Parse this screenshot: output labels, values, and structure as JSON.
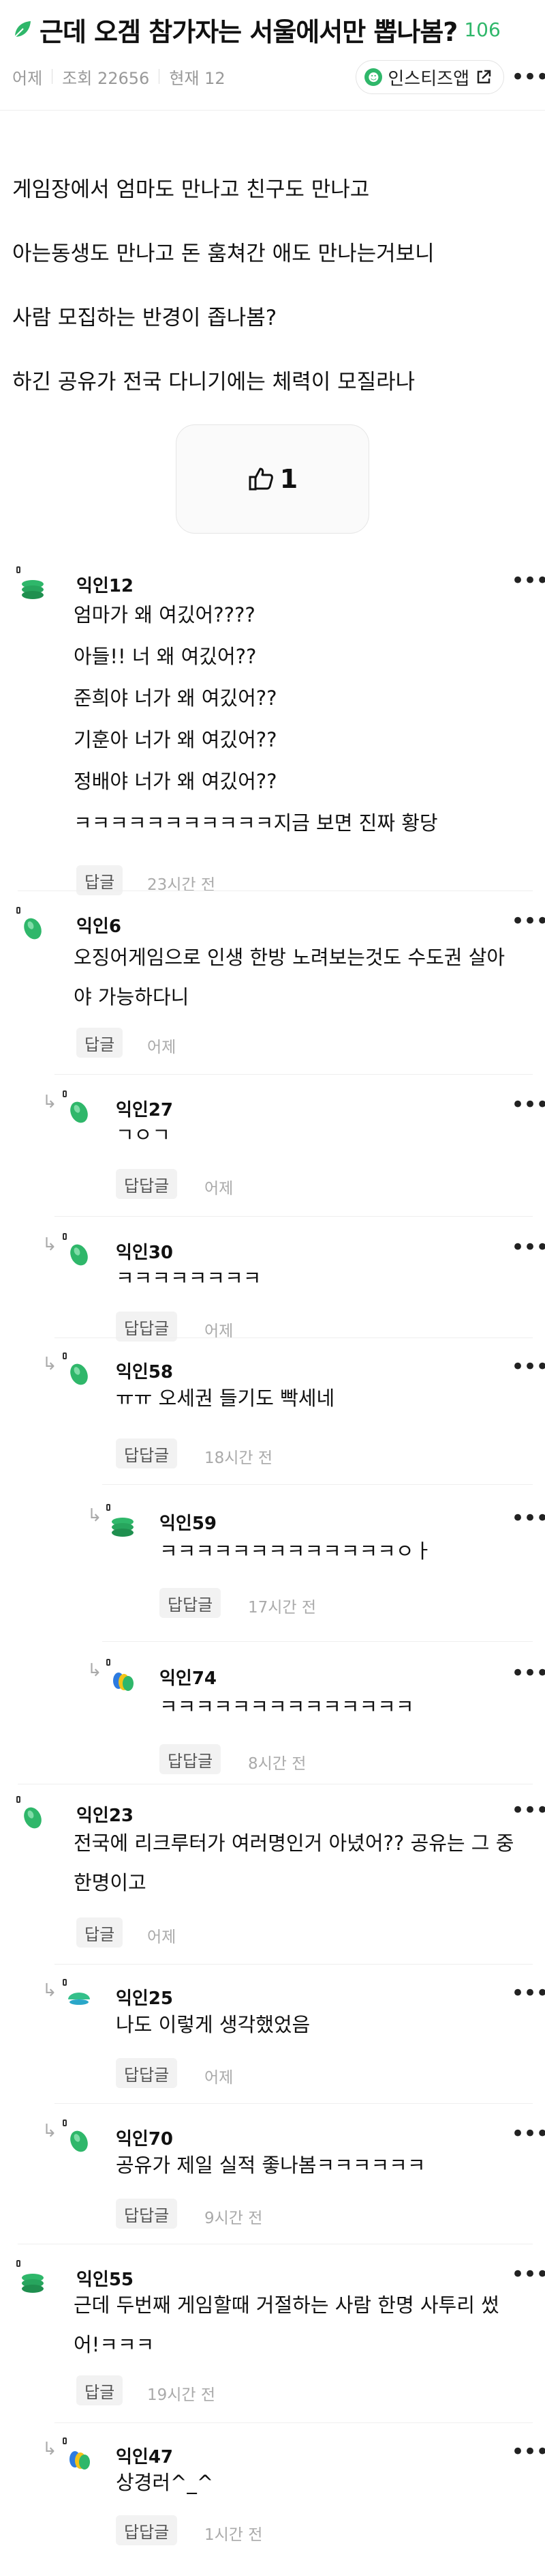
{
  "header": {
    "title": "근데 오겜 참가자는 서울에서만 뽑나봄?",
    "title_count": "106",
    "meta": [
      "어제",
      "조회 22656",
      "현재 12"
    ],
    "app_button": "인스티즈앱"
  },
  "post": {
    "lines": [
      "게임장에서 엄마도 만나고 친구도 만나고",
      "아는동생도 만나고 돈 훔쳐간 애도 만나는거보니",
      "사람 모집하는 반경이 좁나봄?",
      "하긴 공유가 전국 다니기에는 체력이 모질라나"
    ],
    "like_count": "1"
  },
  "comments": [
    {
      "name": "익인12",
      "lines": [
        "엄마가 왜 여깄어????",
        "아들!! 너 왜 여깄어??",
        "준희야 너가 왜 여깄어??",
        "기훈아 너가 왜 여깄어??",
        "정배야 너가 왜 여깄어??",
        "ㅋㅋㅋㅋㅋㅋㅋㅋㅋㅋㅋ지금 보면 진짜 황당"
      ],
      "reply_label": "답글",
      "time": "23시간 전"
    },
    {
      "name": "익인6",
      "lines": [
        "오징어게임으로 인생 한방 노려보는것도 수도권 살아",
        "야 가능하다니"
      ],
      "reply_label": "답글",
      "time": "어제"
    },
    {
      "name": "익인27",
      "lines": [
        "ㄱㅇㄱ"
      ],
      "reply_label": "답답글",
      "time": "어제"
    },
    {
      "name": "익인30",
      "lines": [
        "ㅋㅋㅋㅋㅋㅋㅋㅋ"
      ],
      "reply_label": "답답글",
      "time": "어제"
    },
    {
      "name": "익인58",
      "lines": [
        "ㅠㅠ 오세권 들기도 빡세네"
      ],
      "reply_label": "답답글",
      "time": "18시간 전"
    },
    {
      "name": "익인59",
      "lines": [
        "ㅋㅋㅋㅋㅋㅋㅋㅋㅋㅋㅋㅋㅋㅇㅏ"
      ],
      "reply_label": "답답글",
      "time": "17시간 전"
    },
    {
      "name": "익인74",
      "lines": [
        "ㅋㅋㅋㅋㅋㅋㅋㅋㅋㅋㅋㅋㅋㅋ"
      ],
      "reply_label": "답답글",
      "time": "8시간 전"
    },
    {
      "name": "익인23",
      "lines": [
        "전국에 리크루터가 여러명인거 아녔어?? 공유는 그 중",
        "한명이고"
      ],
      "reply_label": "답글",
      "time": "어제"
    },
    {
      "name": "익인25",
      "lines": [
        "나도 이렇게 생각했었음"
      ],
      "reply_label": "답답글",
      "time": "어제"
    },
    {
      "name": "익인70",
      "lines": [
        "공유가 제일 실적 좋나봄ㅋㅋㅋㅋㅋㅋ"
      ],
      "reply_label": "답답글",
      "time": "9시간 전"
    },
    {
      "name": "익인55",
      "lines": [
        "근데 두번째 게임할때 거절하는 사람 한명 사투리 썼",
        "어!ㅋㅋㅋ"
      ],
      "reply_label": "답글",
      "time": "19시간 전"
    },
    {
      "name": "익인47",
      "lines": [
        "상경러^_^"
      ],
      "reply_label": "답답글",
      "time": "1시간 전"
    }
  ],
  "colors": {
    "accent": "#2fb76a",
    "bubble_blue": "#2d7be0",
    "bubble_yellow": "#f2c318"
  }
}
